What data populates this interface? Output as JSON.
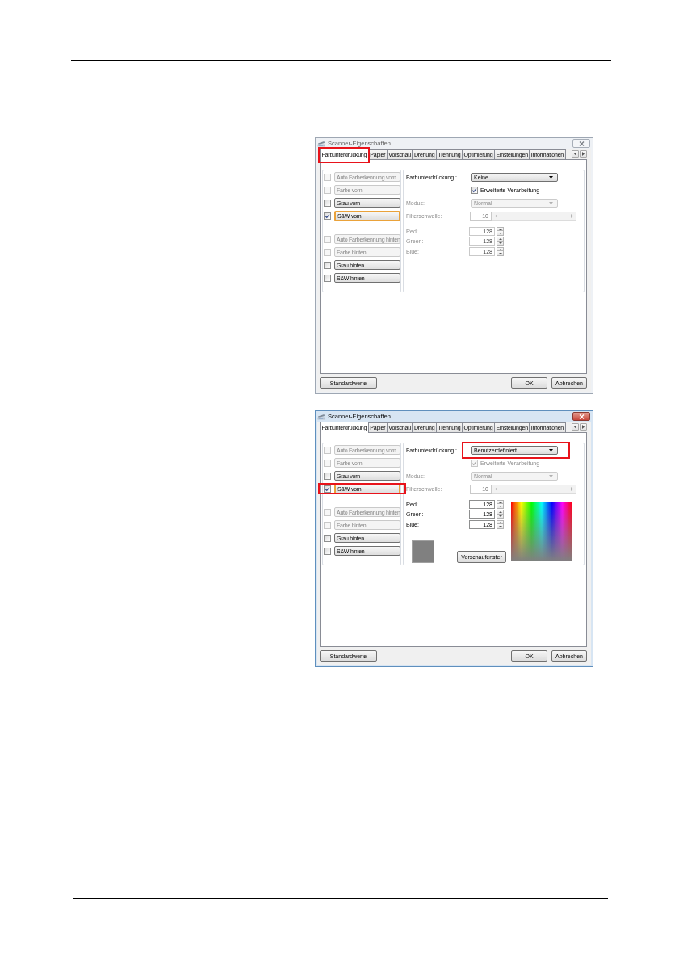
{
  "dialogs": [
    {
      "title": "Scanner-Eigenschaften",
      "active": false,
      "tabs": [
        {
          "label": "Farbunterdrückung",
          "selected": true,
          "highlighted": true
        },
        {
          "label": "Papier",
          "selected": false,
          "highlighted": false
        },
        {
          "label": "Vorschau",
          "selected": false,
          "highlighted": false
        },
        {
          "label": "Drehung",
          "selected": false,
          "highlighted": false
        },
        {
          "label": "Trennung",
          "selected": false,
          "highlighted": false
        },
        {
          "label": "Optimierung",
          "selected": false,
          "highlighted": false
        },
        {
          "label": "Einstellungen",
          "selected": false,
          "highlighted": false
        },
        {
          "label": "Informationen",
          "selected": false,
          "highlighted": false
        }
      ],
      "source_groups": [
        {
          "rows": [
            {
              "label": "Auto Farberkennung vorn",
              "checked": false,
              "disabled": true,
              "focused": false,
              "highlighted": false
            },
            {
              "label": "Farbe vorn",
              "checked": false,
              "disabled": true,
              "focused": false,
              "highlighted": false
            },
            {
              "label": "Grau vorn",
              "checked": false,
              "disabled": false,
              "focused": false,
              "highlighted": false
            },
            {
              "label": "S&W vorn",
              "checked": true,
              "disabled": false,
              "focused": true,
              "highlighted": false
            }
          ]
        },
        {
          "rows": [
            {
              "label": "Auto Farberkennung hinten",
              "checked": false,
              "disabled": true,
              "focused": false,
              "highlighted": false
            },
            {
              "label": "Farbe hinten",
              "checked": false,
              "disabled": true,
              "focused": false,
              "highlighted": false
            },
            {
              "label": "Grau hinten",
              "checked": false,
              "disabled": false,
              "focused": false,
              "highlighted": false
            },
            {
              "label": "S&W hinten",
              "checked": false,
              "disabled": false,
              "focused": false,
              "highlighted": false
            }
          ]
        }
      ],
      "suppression": {
        "label": "Farbunterdrückung :",
        "value": "Keine",
        "highlighted": false
      },
      "advanced": {
        "label": "Erweiterte Verarbeitung",
        "checked": true,
        "disabled": false
      },
      "mode": {
        "label": "Modus:",
        "value": "Normal",
        "disabled": true
      },
      "threshold": {
        "label": "Filterschwelle:",
        "value": "10",
        "disabled": true
      },
      "channels": [
        {
          "label": "Red:",
          "value": "128",
          "disabled": true
        },
        {
          "label": "Green:",
          "value": "128",
          "disabled": true
        },
        {
          "label": "Blue:",
          "value": "128",
          "disabled": true
        }
      ],
      "buttons": [
        "Standardwerte",
        "OK",
        "Abbrechen"
      ]
    },
    {
      "title": "Scanner-Eigenschaften",
      "active": true,
      "tabs": [
        {
          "label": "Farbunterdrückung",
          "selected": true,
          "highlighted": false
        },
        {
          "label": "Papier",
          "selected": false,
          "highlighted": false
        },
        {
          "label": "Vorschau",
          "selected": false,
          "highlighted": false
        },
        {
          "label": "Drehung",
          "selected": false,
          "highlighted": false
        },
        {
          "label": "Trennung",
          "selected": false,
          "highlighted": false
        },
        {
          "label": "Optimierung",
          "selected": false,
          "highlighted": false
        },
        {
          "label": "Einstellungen",
          "selected": false,
          "highlighted": false
        },
        {
          "label": "Informationen",
          "selected": false,
          "highlighted": false
        }
      ],
      "source_groups": [
        {
          "rows": [
            {
              "label": "Auto Farberkennung vorn",
              "checked": false,
              "disabled": true,
              "focused": false,
              "highlighted": false
            },
            {
              "label": "Farbe vorn",
              "checked": false,
              "disabled": true,
              "focused": false,
              "highlighted": false
            },
            {
              "label": "Grau vorn",
              "checked": false,
              "disabled": false,
              "focused": false,
              "highlighted": false
            },
            {
              "label": "S&W vorn",
              "checked": true,
              "disabled": false,
              "focused": true,
              "highlighted": true
            }
          ]
        },
        {
          "rows": [
            {
              "label": "Auto Farberkennung hinten",
              "checked": false,
              "disabled": true,
              "focused": false,
              "highlighted": false
            },
            {
              "label": "Farbe hinten",
              "checked": false,
              "disabled": true,
              "focused": false,
              "highlighted": false
            },
            {
              "label": "Grau hinten",
              "checked": false,
              "disabled": false,
              "focused": false,
              "highlighted": false
            },
            {
              "label": "S&W hinten",
              "checked": false,
              "disabled": false,
              "focused": false,
              "highlighted": false
            }
          ]
        }
      ],
      "suppression": {
        "label": "Farbunterdrückung :",
        "value": "Benutzerdefiniert",
        "highlighted": true
      },
      "advanced": {
        "label": "Erweiterte Verarbeitung",
        "checked": true,
        "disabled": true
      },
      "mode": {
        "label": "Modus:",
        "value": "Normal",
        "disabled": true
      },
      "threshold": {
        "label": "Filterschwelle:",
        "value": "10",
        "disabled": true
      },
      "channels": [
        {
          "label": "Red:",
          "value": "128",
          "disabled": false
        },
        {
          "label": "Green:",
          "value": "128",
          "disabled": false
        },
        {
          "label": "Blue:",
          "value": "128",
          "disabled": false
        }
      ],
      "preview": {
        "button": "Vorschaufenster"
      },
      "buttons": [
        "Standardwerte",
        "OK",
        "Abbrechen"
      ]
    }
  ]
}
